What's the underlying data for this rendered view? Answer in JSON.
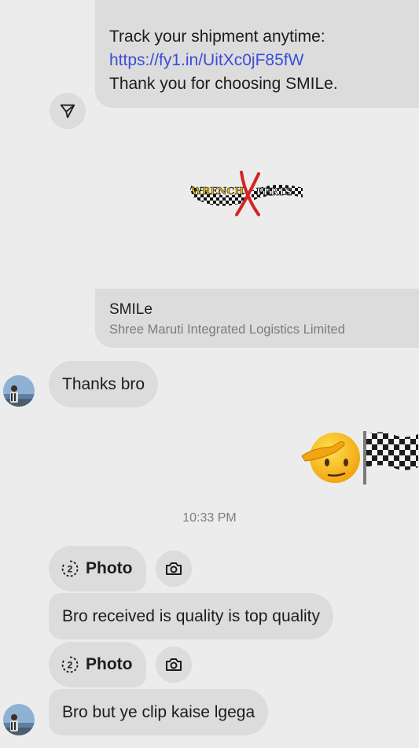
{
  "shipment_message": {
    "line1": "Track your shipment anytime:",
    "link": "https://fy1.in/UitXc0jF85fW",
    "line2": "Thank you for choosing SMILe."
  },
  "logo": {
    "word_left": "WRENCH",
    "word_right": "PERTS"
  },
  "sender": {
    "name": "SMILe",
    "subtitle": "Shree Maruti Integrated Logistics Limited"
  },
  "messages": {
    "thanks": "Thanks bro",
    "timestamp": "10:33 PM",
    "photo_label_1": "Photo",
    "photo_label_2": "Photo",
    "received": "Bro received is quality is top quality",
    "clip": "Bro but ye clip kaise lgega"
  },
  "icons": {
    "share": "send-icon",
    "camera": "camera-icon",
    "view_once": "view-once-icon"
  },
  "colors": {
    "background": "#ececec",
    "bubble": "#dcdcdc",
    "link": "#3a4dd8",
    "muted_text": "#7c7c7c"
  }
}
